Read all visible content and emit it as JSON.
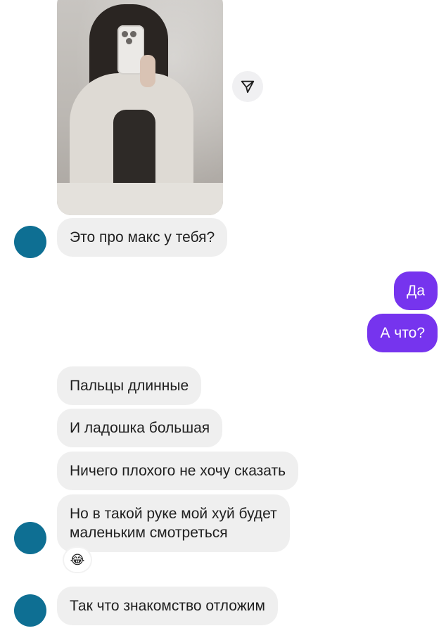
{
  "thread": {
    "messages": [
      {
        "id": "m1",
        "side": "incoming",
        "text": "Это про макс у тебя?"
      },
      {
        "id": "m2",
        "side": "outgoing",
        "text": "Да"
      },
      {
        "id": "m3",
        "side": "outgoing",
        "text": "А что?"
      },
      {
        "id": "m4",
        "side": "incoming",
        "text": "Пальцы длинные"
      },
      {
        "id": "m5",
        "side": "incoming",
        "text": "И ладошка большая"
      },
      {
        "id": "m6",
        "side": "incoming",
        "text": "Ничего плохого не хочу сказать"
      },
      {
        "id": "m7",
        "side": "incoming",
        "line1": "Но в такой руке мой хуй будет",
        "line2": "маленьким смотреться"
      },
      {
        "id": "m8",
        "side": "incoming",
        "text": "Так что знакомство отложим"
      }
    ],
    "reaction": {
      "icon": "laughing-tears-emoji-icon",
      "emoji": "😂"
    }
  },
  "share": {
    "icon": "send-arrow-icon"
  },
  "colors": {
    "incoming_bubble": "#efefef",
    "outgoing_bubble": "#7634ee",
    "avatar": "#0e6f93",
    "text_dark": "#1f1f1f",
    "text_light": "#ffffff"
  }
}
